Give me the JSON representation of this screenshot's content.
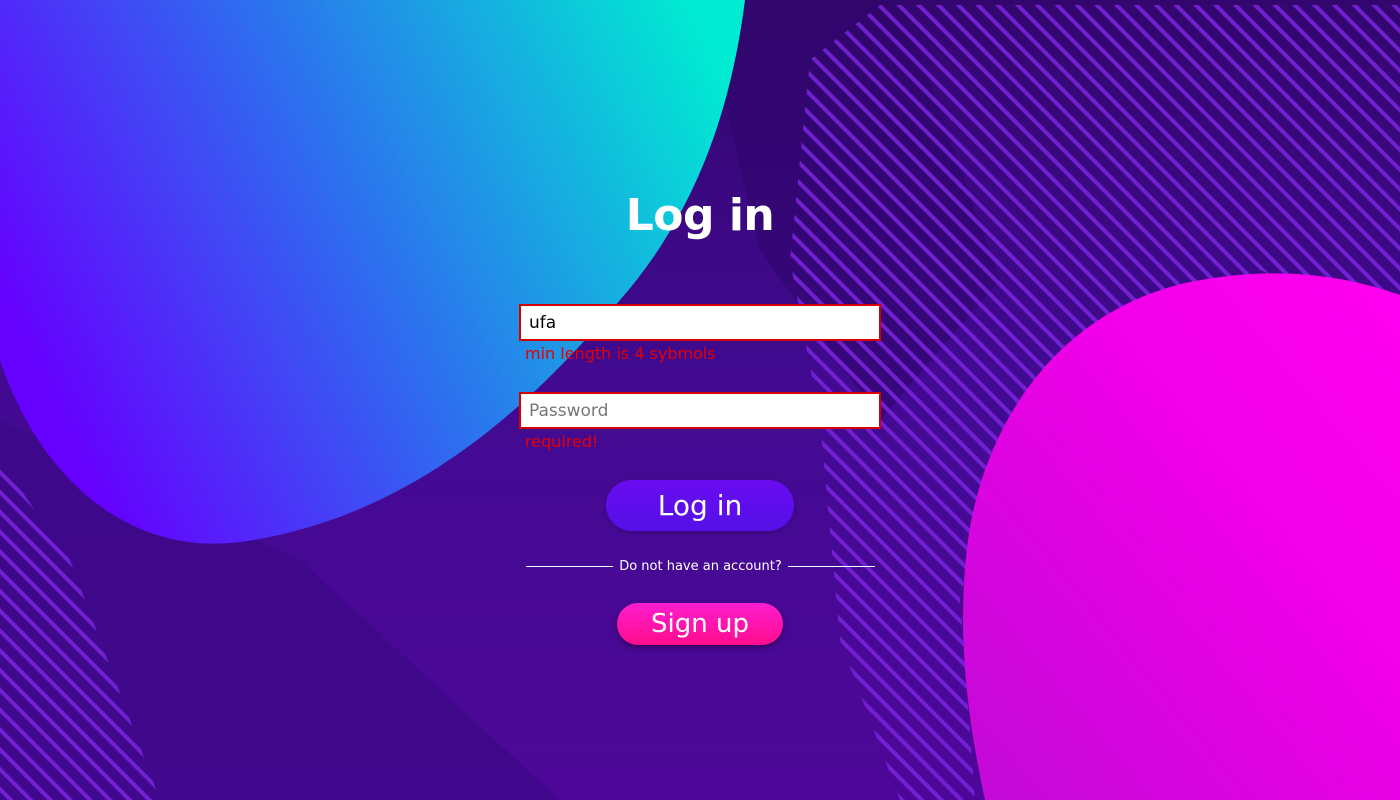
{
  "page": {
    "title": "Log in"
  },
  "form": {
    "username": {
      "value": "ufa",
      "placeholder": "",
      "error": "min length is 4 sybmols"
    },
    "password": {
      "value": "",
      "placeholder": "Password",
      "error": "required!"
    },
    "login_button": "Log in",
    "divider_text": "Do not have an account?",
    "signup_button": "Sign up"
  },
  "colors": {
    "background": "#3f0b8e",
    "error": "#e40000",
    "login_button": "#5a0ff0",
    "signup_button": "#ff1aa8",
    "blob_left_start": "#6a00ff",
    "blob_left_end": "#00e5d0",
    "blob_right": "#ff00e6"
  }
}
